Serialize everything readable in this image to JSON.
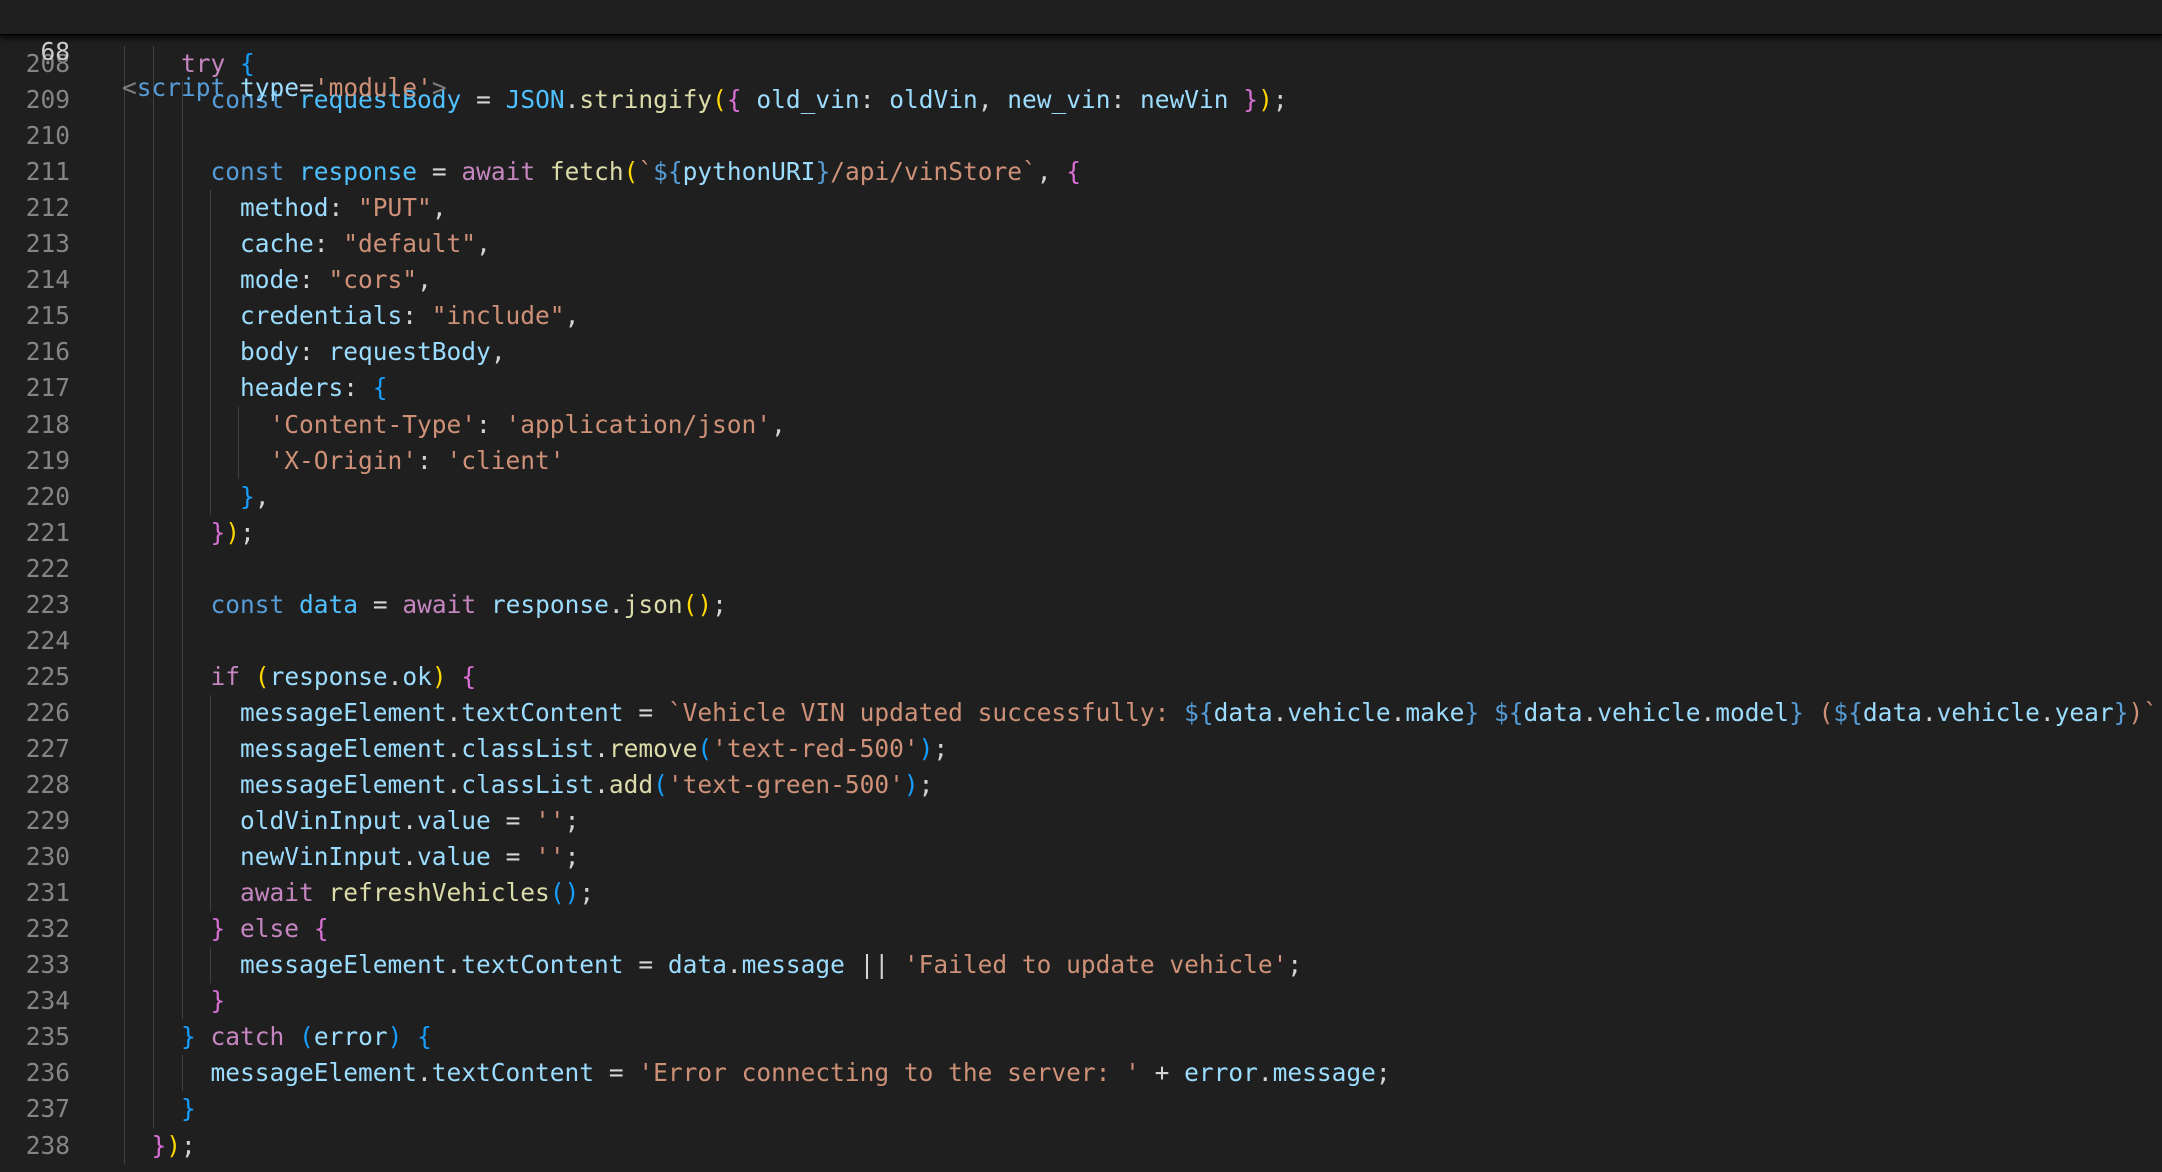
{
  "editor": {
    "sticky": {
      "number": "68",
      "tokens": [
        {
          "t": "<",
          "c": "ang"
        },
        {
          "t": "script",
          "c": "tag"
        },
        {
          "t": " ",
          "c": "pl"
        },
        {
          "t": "type",
          "c": "atr"
        },
        {
          "t": "=",
          "c": "pl"
        },
        {
          "t": "'module'",
          "c": "str"
        },
        {
          "t": ">",
          "c": "ang"
        }
      ]
    },
    "lines": [
      {
        "number": "208",
        "tokens": [
          {
            "t": "    ",
            "c": "pl"
          },
          {
            "t": "try",
            "c": "ctl"
          },
          {
            "t": " ",
            "c": "pl"
          },
          {
            "t": "{",
            "c": "b3"
          }
        ]
      },
      {
        "number": "209",
        "tokens": [
          {
            "t": "      ",
            "c": "pl"
          },
          {
            "t": "const",
            "c": "kw"
          },
          {
            "t": " ",
            "c": "pl"
          },
          {
            "t": "requestBody",
            "c": "cst"
          },
          {
            "t": " = ",
            "c": "pl"
          },
          {
            "t": "JSON",
            "c": "cst"
          },
          {
            "t": ".",
            "c": "pl"
          },
          {
            "t": "stringify",
            "c": "fn"
          },
          {
            "t": "(",
            "c": "b1"
          },
          {
            "t": "{",
            "c": "b2"
          },
          {
            "t": " ",
            "c": "pl"
          },
          {
            "t": "old_vin",
            "c": "var"
          },
          {
            "t": ": ",
            "c": "pl"
          },
          {
            "t": "oldVin",
            "c": "var"
          },
          {
            "t": ", ",
            "c": "pl"
          },
          {
            "t": "new_vin",
            "c": "var"
          },
          {
            "t": ": ",
            "c": "pl"
          },
          {
            "t": "newVin",
            "c": "var"
          },
          {
            "t": " ",
            "c": "pl"
          },
          {
            "t": "}",
            "c": "b2"
          },
          {
            "t": ")",
            "c": "b1"
          },
          {
            "t": ";",
            "c": "pl"
          }
        ]
      },
      {
        "number": "210",
        "tokens": []
      },
      {
        "number": "211",
        "tokens": [
          {
            "t": "      ",
            "c": "pl"
          },
          {
            "t": "const",
            "c": "kw"
          },
          {
            "t": " ",
            "c": "pl"
          },
          {
            "t": "response",
            "c": "cst"
          },
          {
            "t": " = ",
            "c": "pl"
          },
          {
            "t": "await",
            "c": "ctl"
          },
          {
            "t": " ",
            "c": "pl"
          },
          {
            "t": "fetch",
            "c": "fn"
          },
          {
            "t": "(",
            "c": "b1"
          },
          {
            "t": "`",
            "c": "str"
          },
          {
            "t": "${",
            "c": "kw"
          },
          {
            "t": "pythonURI",
            "c": "var"
          },
          {
            "t": "}",
            "c": "kw"
          },
          {
            "t": "/api/vinStore`",
            "c": "str"
          },
          {
            "t": ", ",
            "c": "pl"
          },
          {
            "t": "{",
            "c": "b2"
          }
        ]
      },
      {
        "number": "212",
        "tokens": [
          {
            "t": "        ",
            "c": "pl"
          },
          {
            "t": "method",
            "c": "var"
          },
          {
            "t": ": ",
            "c": "pl"
          },
          {
            "t": "\"PUT\"",
            "c": "str"
          },
          {
            "t": ",",
            "c": "pl"
          }
        ]
      },
      {
        "number": "213",
        "tokens": [
          {
            "t": "        ",
            "c": "pl"
          },
          {
            "t": "cache",
            "c": "var"
          },
          {
            "t": ": ",
            "c": "pl"
          },
          {
            "t": "\"default\"",
            "c": "str"
          },
          {
            "t": ",",
            "c": "pl"
          }
        ]
      },
      {
        "number": "214",
        "tokens": [
          {
            "t": "        ",
            "c": "pl"
          },
          {
            "t": "mode",
            "c": "var"
          },
          {
            "t": ": ",
            "c": "pl"
          },
          {
            "t": "\"cors\"",
            "c": "str"
          },
          {
            "t": ",",
            "c": "pl"
          }
        ]
      },
      {
        "number": "215",
        "tokens": [
          {
            "t": "        ",
            "c": "pl"
          },
          {
            "t": "credentials",
            "c": "var"
          },
          {
            "t": ": ",
            "c": "pl"
          },
          {
            "t": "\"include\"",
            "c": "str"
          },
          {
            "t": ",",
            "c": "pl"
          }
        ]
      },
      {
        "number": "216",
        "tokens": [
          {
            "t": "        ",
            "c": "pl"
          },
          {
            "t": "body",
            "c": "var"
          },
          {
            "t": ": ",
            "c": "pl"
          },
          {
            "t": "requestBody",
            "c": "var"
          },
          {
            "t": ",",
            "c": "pl"
          }
        ]
      },
      {
        "number": "217",
        "tokens": [
          {
            "t": "        ",
            "c": "pl"
          },
          {
            "t": "headers",
            "c": "var"
          },
          {
            "t": ": ",
            "c": "pl"
          },
          {
            "t": "{",
            "c": "b3"
          }
        ]
      },
      {
        "number": "218",
        "tokens": [
          {
            "t": "          ",
            "c": "pl"
          },
          {
            "t": "'Content-Type'",
            "c": "str"
          },
          {
            "t": ": ",
            "c": "pl"
          },
          {
            "t": "'application/json'",
            "c": "str"
          },
          {
            "t": ",",
            "c": "pl"
          }
        ]
      },
      {
        "number": "219",
        "tokens": [
          {
            "t": "          ",
            "c": "pl"
          },
          {
            "t": "'X-Origin'",
            "c": "str"
          },
          {
            "t": ": ",
            "c": "pl"
          },
          {
            "t": "'client'",
            "c": "str"
          }
        ]
      },
      {
        "number": "220",
        "tokens": [
          {
            "t": "        ",
            "c": "pl"
          },
          {
            "t": "}",
            "c": "b3"
          },
          {
            "t": ",",
            "c": "pl"
          }
        ]
      },
      {
        "number": "221",
        "tokens": [
          {
            "t": "      ",
            "c": "pl"
          },
          {
            "t": "}",
            "c": "b2"
          },
          {
            "t": ")",
            "c": "b1"
          },
          {
            "t": ";",
            "c": "pl"
          }
        ]
      },
      {
        "number": "222",
        "tokens": []
      },
      {
        "number": "223",
        "tokens": [
          {
            "t": "      ",
            "c": "pl"
          },
          {
            "t": "const",
            "c": "kw"
          },
          {
            "t": " ",
            "c": "pl"
          },
          {
            "t": "data",
            "c": "cst"
          },
          {
            "t": " = ",
            "c": "pl"
          },
          {
            "t": "await",
            "c": "ctl"
          },
          {
            "t": " ",
            "c": "pl"
          },
          {
            "t": "response",
            "c": "var"
          },
          {
            "t": ".",
            "c": "pl"
          },
          {
            "t": "json",
            "c": "fn"
          },
          {
            "t": "()",
            "c": "b1"
          },
          {
            "t": ";",
            "c": "pl"
          }
        ]
      },
      {
        "number": "224",
        "tokens": []
      },
      {
        "number": "225",
        "tokens": [
          {
            "t": "      ",
            "c": "pl"
          },
          {
            "t": "if",
            "c": "ctl"
          },
          {
            "t": " ",
            "c": "pl"
          },
          {
            "t": "(",
            "c": "b1"
          },
          {
            "t": "response",
            "c": "var"
          },
          {
            "t": ".",
            "c": "pl"
          },
          {
            "t": "ok",
            "c": "var"
          },
          {
            "t": ")",
            "c": "b1"
          },
          {
            "t": " ",
            "c": "pl"
          },
          {
            "t": "{",
            "c": "b2"
          }
        ]
      },
      {
        "number": "226",
        "tokens": [
          {
            "t": "        ",
            "c": "pl"
          },
          {
            "t": "messageElement",
            "c": "var"
          },
          {
            "t": ".",
            "c": "pl"
          },
          {
            "t": "textContent",
            "c": "var"
          },
          {
            "t": " = ",
            "c": "pl"
          },
          {
            "t": "`Vehicle VIN updated successfully: ",
            "c": "str"
          },
          {
            "t": "${",
            "c": "kw"
          },
          {
            "t": "data",
            "c": "var"
          },
          {
            "t": ".",
            "c": "pl"
          },
          {
            "t": "vehicle",
            "c": "var"
          },
          {
            "t": ".",
            "c": "pl"
          },
          {
            "t": "make",
            "c": "var"
          },
          {
            "t": "}",
            "c": "kw"
          },
          {
            "t": " ",
            "c": "str"
          },
          {
            "t": "${",
            "c": "kw"
          },
          {
            "t": "data",
            "c": "var"
          },
          {
            "t": ".",
            "c": "pl"
          },
          {
            "t": "vehicle",
            "c": "var"
          },
          {
            "t": ".",
            "c": "pl"
          },
          {
            "t": "model",
            "c": "var"
          },
          {
            "t": "}",
            "c": "kw"
          },
          {
            "t": " (",
            "c": "str"
          },
          {
            "t": "${",
            "c": "kw"
          },
          {
            "t": "data",
            "c": "var"
          },
          {
            "t": ".",
            "c": "pl"
          },
          {
            "t": "vehicle",
            "c": "var"
          },
          {
            "t": ".",
            "c": "pl"
          },
          {
            "t": "year",
            "c": "var"
          },
          {
            "t": "}",
            "c": "kw"
          },
          {
            "t": ")`",
            "c": "str"
          },
          {
            "t": ";",
            "c": "pl"
          }
        ]
      },
      {
        "number": "227",
        "tokens": [
          {
            "t": "        ",
            "c": "pl"
          },
          {
            "t": "messageElement",
            "c": "var"
          },
          {
            "t": ".",
            "c": "pl"
          },
          {
            "t": "classList",
            "c": "var"
          },
          {
            "t": ".",
            "c": "pl"
          },
          {
            "t": "remove",
            "c": "fn"
          },
          {
            "t": "(",
            "c": "b3"
          },
          {
            "t": "'text-red-500'",
            "c": "str"
          },
          {
            "t": ")",
            "c": "b3"
          },
          {
            "t": ";",
            "c": "pl"
          }
        ]
      },
      {
        "number": "228",
        "tokens": [
          {
            "t": "        ",
            "c": "pl"
          },
          {
            "t": "messageElement",
            "c": "var"
          },
          {
            "t": ".",
            "c": "pl"
          },
          {
            "t": "classList",
            "c": "var"
          },
          {
            "t": ".",
            "c": "pl"
          },
          {
            "t": "add",
            "c": "fn"
          },
          {
            "t": "(",
            "c": "b3"
          },
          {
            "t": "'text-green-500'",
            "c": "str"
          },
          {
            "t": ")",
            "c": "b3"
          },
          {
            "t": ";",
            "c": "pl"
          }
        ]
      },
      {
        "number": "229",
        "tokens": [
          {
            "t": "        ",
            "c": "pl"
          },
          {
            "t": "oldVinInput",
            "c": "var"
          },
          {
            "t": ".",
            "c": "pl"
          },
          {
            "t": "value",
            "c": "var"
          },
          {
            "t": " = ",
            "c": "pl"
          },
          {
            "t": "''",
            "c": "str"
          },
          {
            "t": ";",
            "c": "pl"
          }
        ]
      },
      {
        "number": "230",
        "tokens": [
          {
            "t": "        ",
            "c": "pl"
          },
          {
            "t": "newVinInput",
            "c": "var"
          },
          {
            "t": ".",
            "c": "pl"
          },
          {
            "t": "value",
            "c": "var"
          },
          {
            "t": " = ",
            "c": "pl"
          },
          {
            "t": "''",
            "c": "str"
          },
          {
            "t": ";",
            "c": "pl"
          }
        ]
      },
      {
        "number": "231",
        "tokens": [
          {
            "t": "        ",
            "c": "pl"
          },
          {
            "t": "await",
            "c": "ctl"
          },
          {
            "t": " ",
            "c": "pl"
          },
          {
            "t": "refreshVehicles",
            "c": "fn"
          },
          {
            "t": "()",
            "c": "b3"
          },
          {
            "t": ";",
            "c": "pl"
          }
        ]
      },
      {
        "number": "232",
        "tokens": [
          {
            "t": "      ",
            "c": "pl"
          },
          {
            "t": "}",
            "c": "b2"
          },
          {
            "t": " ",
            "c": "pl"
          },
          {
            "t": "else",
            "c": "ctl"
          },
          {
            "t": " ",
            "c": "pl"
          },
          {
            "t": "{",
            "c": "b2"
          }
        ]
      },
      {
        "number": "233",
        "tokens": [
          {
            "t": "        ",
            "c": "pl"
          },
          {
            "t": "messageElement",
            "c": "var"
          },
          {
            "t": ".",
            "c": "pl"
          },
          {
            "t": "textContent",
            "c": "var"
          },
          {
            "t": " = ",
            "c": "pl"
          },
          {
            "t": "data",
            "c": "var"
          },
          {
            "t": ".",
            "c": "pl"
          },
          {
            "t": "message",
            "c": "var"
          },
          {
            "t": " || ",
            "c": "pl"
          },
          {
            "t": "'Failed to update vehicle'",
            "c": "str"
          },
          {
            "t": ";",
            "c": "pl"
          }
        ]
      },
      {
        "number": "234",
        "tokens": [
          {
            "t": "      ",
            "c": "pl"
          },
          {
            "t": "}",
            "c": "b2"
          }
        ]
      },
      {
        "number": "235",
        "tokens": [
          {
            "t": "    ",
            "c": "pl"
          },
          {
            "t": "}",
            "c": "b3"
          },
          {
            "t": " ",
            "c": "pl"
          },
          {
            "t": "catch",
            "c": "ctl"
          },
          {
            "t": " ",
            "c": "pl"
          },
          {
            "t": "(",
            "c": "b3"
          },
          {
            "t": "error",
            "c": "var"
          },
          {
            "t": ")",
            "c": "b3"
          },
          {
            "t": " ",
            "c": "pl"
          },
          {
            "t": "{",
            "c": "b3"
          }
        ]
      },
      {
        "number": "236",
        "tokens": [
          {
            "t": "      ",
            "c": "pl"
          },
          {
            "t": "messageElement",
            "c": "var"
          },
          {
            "t": ".",
            "c": "pl"
          },
          {
            "t": "textContent",
            "c": "var"
          },
          {
            "t": " = ",
            "c": "pl"
          },
          {
            "t": "'Error connecting to the server: '",
            "c": "str"
          },
          {
            "t": " + ",
            "c": "pl"
          },
          {
            "t": "error",
            "c": "var"
          },
          {
            "t": ".",
            "c": "pl"
          },
          {
            "t": "message",
            "c": "var"
          },
          {
            "t": ";",
            "c": "pl"
          }
        ]
      },
      {
        "number": "237",
        "tokens": [
          {
            "t": "    ",
            "c": "pl"
          },
          {
            "t": "}",
            "c": "b3"
          }
        ]
      },
      {
        "number": "238",
        "tokens": [
          {
            "t": "  ",
            "c": "pl"
          },
          {
            "t": "}",
            "c": "b2"
          },
          {
            "t": ")",
            "c": "b1"
          },
          {
            "t": ";",
            "c": "pl"
          }
        ]
      }
    ]
  }
}
